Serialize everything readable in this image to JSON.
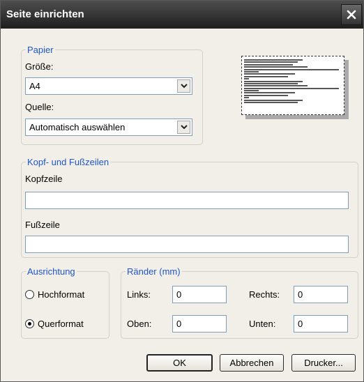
{
  "window": {
    "title": "Seite einrichten"
  },
  "paper": {
    "legend": "Papier",
    "size_label": "Größe:",
    "size_value": "A4",
    "source_label": "Quelle:",
    "source_value": "Automatisch auswählen"
  },
  "preview": {
    "icon": "page-preview-icon"
  },
  "header_footer": {
    "legend": "Kopf- und Fußzeilen",
    "header_label": "Kopfzeile",
    "header_value": "",
    "footer_label": "Fußzeile",
    "footer_value": ""
  },
  "orientation": {
    "legend": "Ausrichtung",
    "portrait_label": "Hochformat",
    "landscape_label": "Querformat",
    "selected": "landscape"
  },
  "margins": {
    "legend": "Ränder (mm)",
    "left_label": "Links:",
    "left_value": "0",
    "right_label": "Rechts:",
    "right_value": "0",
    "top_label": "Oben:",
    "top_value": "0",
    "bottom_label": "Unten:",
    "bottom_value": "0"
  },
  "buttons": {
    "ok": "OK",
    "cancel": "Abbrechen",
    "printer": "Drucker..."
  }
}
